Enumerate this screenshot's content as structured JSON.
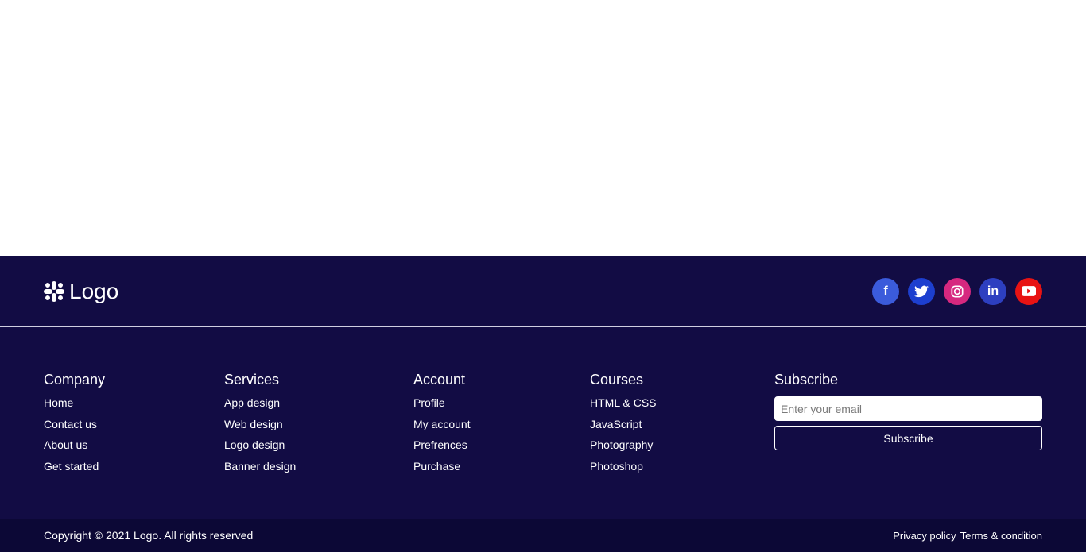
{
  "footer": {
    "brand": {
      "name": "Logo",
      "icon": "slack-icon"
    },
    "social": [
      {
        "name": "facebook",
        "glyph": "f",
        "color": "#3b5bdb"
      },
      {
        "name": "twitter",
        "glyph": "🐦",
        "color": "#1d3fcf"
      },
      {
        "name": "instagram",
        "glyph": "◎",
        "color": "#d6287f"
      },
      {
        "name": "linkedin",
        "glyph": "in",
        "color": "#2d3fc0"
      },
      {
        "name": "youtube",
        "glyph": "▶",
        "color": "#e81313"
      }
    ],
    "company": {
      "title": "Company",
      "links": [
        "Home",
        "Contact us",
        "About us",
        "Get started"
      ]
    },
    "services": {
      "title": "Services",
      "links": [
        "App design",
        "Web design",
        "Logo design",
        "Banner design"
      ]
    },
    "account": {
      "title": "Account",
      "links": [
        "Profile",
        "My account",
        "Prefrences",
        "Purchase"
      ]
    },
    "courses": {
      "title": "Courses",
      "links": [
        "HTML & CSS",
        "JavaScript",
        "Photography",
        "Photoshop"
      ]
    },
    "subscribe": {
      "title": "Subscribe",
      "placeholder": "Enter your email",
      "button": "Subscribe"
    },
    "copyright": "Copyright © 2021 Logo. All rights reserved",
    "legal": {
      "privacy": "Privacy policy",
      "terms": "Terms & condition"
    },
    "colors": {
      "background": "#120c44",
      "bottom_bar": "#0c0836"
    }
  }
}
